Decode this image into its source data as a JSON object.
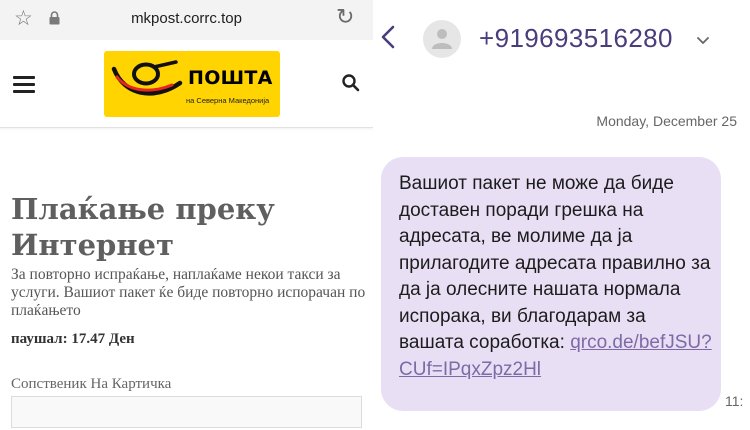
{
  "browser": {
    "url": "mkpost.corrc.top"
  },
  "site": {
    "logo_name": "ПОШТА",
    "logo_subtitle": "на Северна Македонија",
    "brand_color": "#ffd400",
    "title": "Плаќање преку Интернет",
    "intro": "За повторно испраќање, наплаќаме некои такси за услуги. Вашиот пакет ќе биде повторно испорачан по плаќањето",
    "lump_sum": "паушал: 17.47 Ден",
    "card_owner_label": "Сопственик На Картичка",
    "card_owner_value": ""
  },
  "sms": {
    "phone_number": "+919693516280",
    "date": "Monday, December 25",
    "message_text": "Вашиот пакет не може да биде доставен поради грешка на адресата, ве молиме да ја прилагодите адресата правилно за да ја олесните нашата нормала испорака, ви благодарам за вашата соработка: ",
    "message_link": "qrco.de/befJSU?CUf=IPqxZpz2Hl",
    "time": "11:",
    "bubble_color": "#e8dff5",
    "accent_color": "#4a3d7c"
  },
  "icons": {
    "bookmark": "star-icon",
    "security": "lock-icon",
    "reload": "reload-icon",
    "menu": "hamburger-icon",
    "search": "search-icon",
    "back": "back-arrow-icon",
    "contact": "avatar-icon",
    "expand": "chevron-down-icon"
  }
}
